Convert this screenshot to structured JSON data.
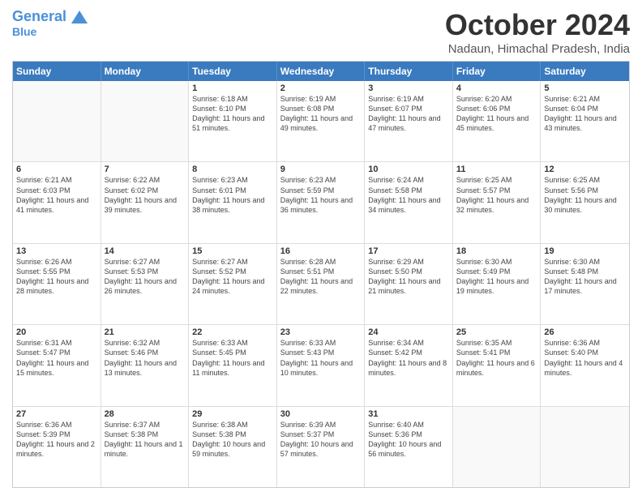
{
  "header": {
    "logo_general": "General",
    "logo_blue": "Blue",
    "month_title": "October 2024",
    "location": "Nadaun, Himachal Pradesh, India"
  },
  "weekdays": [
    "Sunday",
    "Monday",
    "Tuesday",
    "Wednesday",
    "Thursday",
    "Friday",
    "Saturday"
  ],
  "rows": [
    [
      {
        "day": "",
        "sunrise": "",
        "sunset": "",
        "daylight": ""
      },
      {
        "day": "",
        "sunrise": "",
        "sunset": "",
        "daylight": ""
      },
      {
        "day": "1",
        "sunrise": "Sunrise: 6:18 AM",
        "sunset": "Sunset: 6:10 PM",
        "daylight": "Daylight: 11 hours and 51 minutes."
      },
      {
        "day": "2",
        "sunrise": "Sunrise: 6:19 AM",
        "sunset": "Sunset: 6:08 PM",
        "daylight": "Daylight: 11 hours and 49 minutes."
      },
      {
        "day": "3",
        "sunrise": "Sunrise: 6:19 AM",
        "sunset": "Sunset: 6:07 PM",
        "daylight": "Daylight: 11 hours and 47 minutes."
      },
      {
        "day": "4",
        "sunrise": "Sunrise: 6:20 AM",
        "sunset": "Sunset: 6:06 PM",
        "daylight": "Daylight: 11 hours and 45 minutes."
      },
      {
        "day": "5",
        "sunrise": "Sunrise: 6:21 AM",
        "sunset": "Sunset: 6:04 PM",
        "daylight": "Daylight: 11 hours and 43 minutes."
      }
    ],
    [
      {
        "day": "6",
        "sunrise": "Sunrise: 6:21 AM",
        "sunset": "Sunset: 6:03 PM",
        "daylight": "Daylight: 11 hours and 41 minutes."
      },
      {
        "day": "7",
        "sunrise": "Sunrise: 6:22 AM",
        "sunset": "Sunset: 6:02 PM",
        "daylight": "Daylight: 11 hours and 39 minutes."
      },
      {
        "day": "8",
        "sunrise": "Sunrise: 6:23 AM",
        "sunset": "Sunset: 6:01 PM",
        "daylight": "Daylight: 11 hours and 38 minutes."
      },
      {
        "day": "9",
        "sunrise": "Sunrise: 6:23 AM",
        "sunset": "Sunset: 5:59 PM",
        "daylight": "Daylight: 11 hours and 36 minutes."
      },
      {
        "day": "10",
        "sunrise": "Sunrise: 6:24 AM",
        "sunset": "Sunset: 5:58 PM",
        "daylight": "Daylight: 11 hours and 34 minutes."
      },
      {
        "day": "11",
        "sunrise": "Sunrise: 6:25 AM",
        "sunset": "Sunset: 5:57 PM",
        "daylight": "Daylight: 11 hours and 32 minutes."
      },
      {
        "day": "12",
        "sunrise": "Sunrise: 6:25 AM",
        "sunset": "Sunset: 5:56 PM",
        "daylight": "Daylight: 11 hours and 30 minutes."
      }
    ],
    [
      {
        "day": "13",
        "sunrise": "Sunrise: 6:26 AM",
        "sunset": "Sunset: 5:55 PM",
        "daylight": "Daylight: 11 hours and 28 minutes."
      },
      {
        "day": "14",
        "sunrise": "Sunrise: 6:27 AM",
        "sunset": "Sunset: 5:53 PM",
        "daylight": "Daylight: 11 hours and 26 minutes."
      },
      {
        "day": "15",
        "sunrise": "Sunrise: 6:27 AM",
        "sunset": "Sunset: 5:52 PM",
        "daylight": "Daylight: 11 hours and 24 minutes."
      },
      {
        "day": "16",
        "sunrise": "Sunrise: 6:28 AM",
        "sunset": "Sunset: 5:51 PM",
        "daylight": "Daylight: 11 hours and 22 minutes."
      },
      {
        "day": "17",
        "sunrise": "Sunrise: 6:29 AM",
        "sunset": "Sunset: 5:50 PM",
        "daylight": "Daylight: 11 hours and 21 minutes."
      },
      {
        "day": "18",
        "sunrise": "Sunrise: 6:30 AM",
        "sunset": "Sunset: 5:49 PM",
        "daylight": "Daylight: 11 hours and 19 minutes."
      },
      {
        "day": "19",
        "sunrise": "Sunrise: 6:30 AM",
        "sunset": "Sunset: 5:48 PM",
        "daylight": "Daylight: 11 hours and 17 minutes."
      }
    ],
    [
      {
        "day": "20",
        "sunrise": "Sunrise: 6:31 AM",
        "sunset": "Sunset: 5:47 PM",
        "daylight": "Daylight: 11 hours and 15 minutes."
      },
      {
        "day": "21",
        "sunrise": "Sunrise: 6:32 AM",
        "sunset": "Sunset: 5:46 PM",
        "daylight": "Daylight: 11 hours and 13 minutes."
      },
      {
        "day": "22",
        "sunrise": "Sunrise: 6:33 AM",
        "sunset": "Sunset: 5:45 PM",
        "daylight": "Daylight: 11 hours and 11 minutes."
      },
      {
        "day": "23",
        "sunrise": "Sunrise: 6:33 AM",
        "sunset": "Sunset: 5:43 PM",
        "daylight": "Daylight: 11 hours and 10 minutes."
      },
      {
        "day": "24",
        "sunrise": "Sunrise: 6:34 AM",
        "sunset": "Sunset: 5:42 PM",
        "daylight": "Daylight: 11 hours and 8 minutes."
      },
      {
        "day": "25",
        "sunrise": "Sunrise: 6:35 AM",
        "sunset": "Sunset: 5:41 PM",
        "daylight": "Daylight: 11 hours and 6 minutes."
      },
      {
        "day": "26",
        "sunrise": "Sunrise: 6:36 AM",
        "sunset": "Sunset: 5:40 PM",
        "daylight": "Daylight: 11 hours and 4 minutes."
      }
    ],
    [
      {
        "day": "27",
        "sunrise": "Sunrise: 6:36 AM",
        "sunset": "Sunset: 5:39 PM",
        "daylight": "Daylight: 11 hours and 2 minutes."
      },
      {
        "day": "28",
        "sunrise": "Sunrise: 6:37 AM",
        "sunset": "Sunset: 5:38 PM",
        "daylight": "Daylight: 11 hours and 1 minute."
      },
      {
        "day": "29",
        "sunrise": "Sunrise: 6:38 AM",
        "sunset": "Sunset: 5:38 PM",
        "daylight": "Daylight: 10 hours and 59 minutes."
      },
      {
        "day": "30",
        "sunrise": "Sunrise: 6:39 AM",
        "sunset": "Sunset: 5:37 PM",
        "daylight": "Daylight: 10 hours and 57 minutes."
      },
      {
        "day": "31",
        "sunrise": "Sunrise: 6:40 AM",
        "sunset": "Sunset: 5:36 PM",
        "daylight": "Daylight: 10 hours and 56 minutes."
      },
      {
        "day": "",
        "sunrise": "",
        "sunset": "",
        "daylight": ""
      },
      {
        "day": "",
        "sunrise": "",
        "sunset": "",
        "daylight": ""
      }
    ]
  ]
}
